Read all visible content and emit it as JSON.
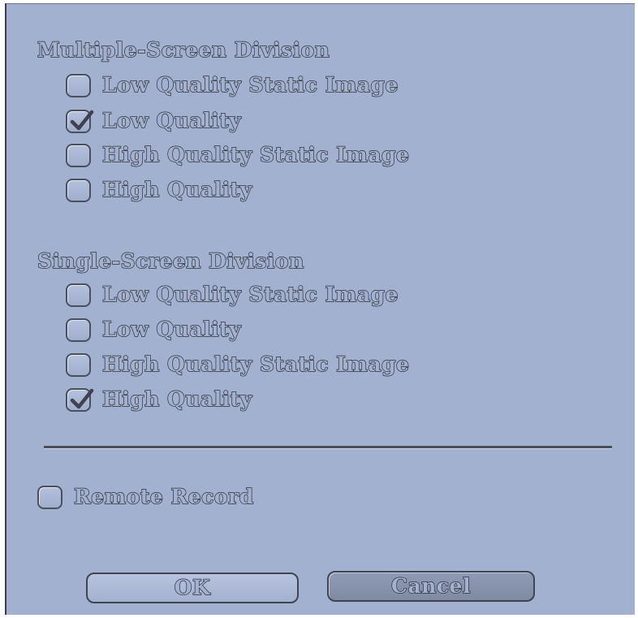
{
  "multi_screen": {
    "title": "Multiple-Screen Division",
    "options": [
      {
        "label": "Low Quality Static Image",
        "checked": false
      },
      {
        "label": "Low Quality",
        "checked": true
      },
      {
        "label": "High Quality Static Image",
        "checked": false
      },
      {
        "label": "High Quality",
        "checked": false
      }
    ]
  },
  "single_screen": {
    "title": "Single-Screen Division",
    "options": [
      {
        "label": "Low Quality Static Image",
        "checked": false
      },
      {
        "label": "Low Quality",
        "checked": false
      },
      {
        "label": "High Quality Static Image",
        "checked": false
      },
      {
        "label": "High Quality",
        "checked": true
      }
    ]
  },
  "remote_record": {
    "label": "Remote Record",
    "checked": false
  },
  "buttons": {
    "ok": "OK",
    "cancel": "Cancel"
  }
}
